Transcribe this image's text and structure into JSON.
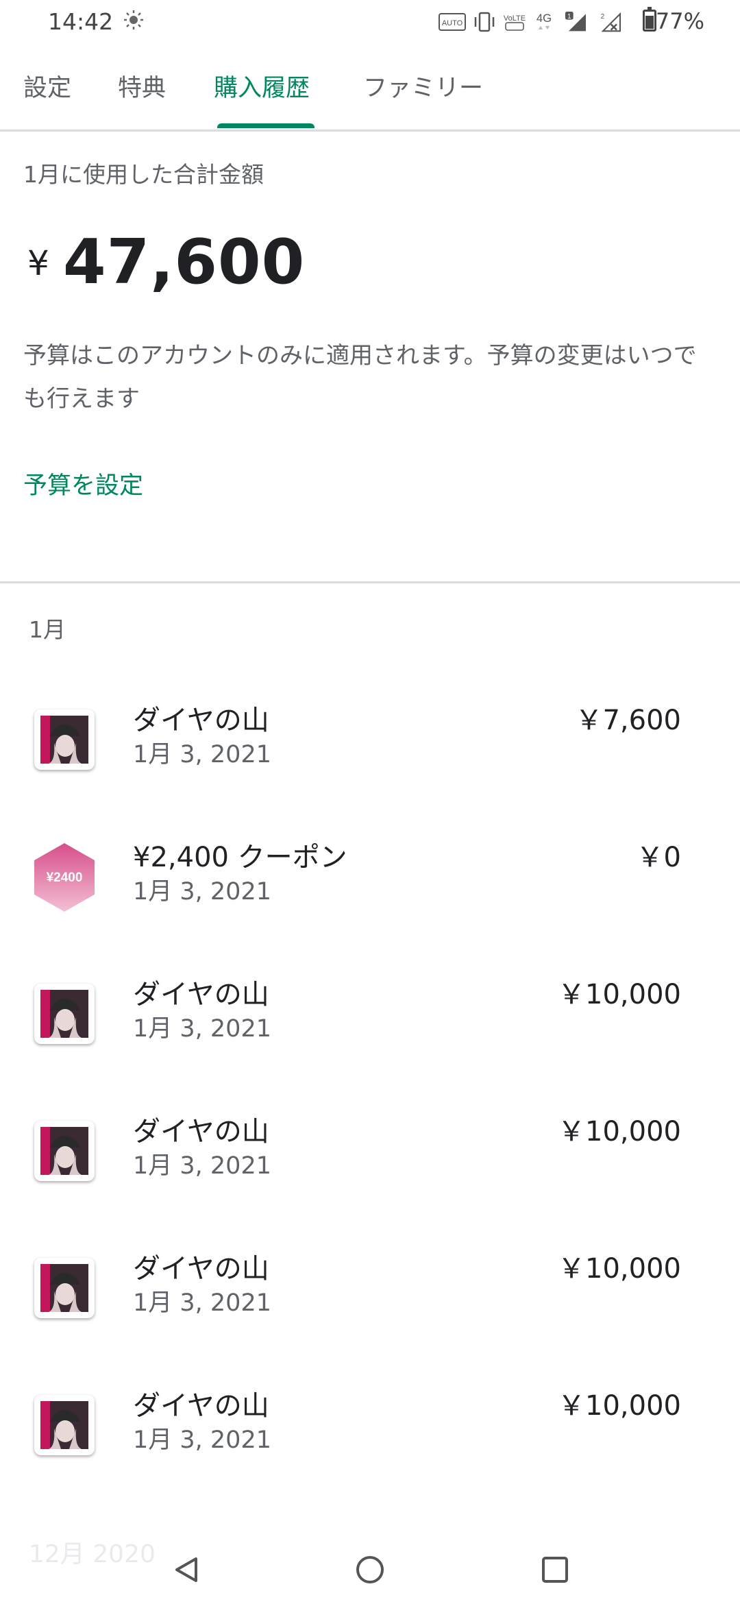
{
  "status_bar": {
    "time": "14:42",
    "battery": "77%",
    "network": "4G",
    "sim_badge": "1",
    "sim2_label": "2",
    "auto_label": "AUTO",
    "volte_label": "VoLTE"
  },
  "tabs": [
    {
      "label": "設定",
      "active": false
    },
    {
      "label": "特典",
      "active": false
    },
    {
      "label": "購入履歴",
      "active": true
    },
    {
      "label": "ファミリー",
      "active": false
    }
  ],
  "summary": {
    "label": "1月に使用した合計金額",
    "currency": "¥",
    "total": "47,600",
    "description": "予算はこのアカウントのみに適用されます。予算の変更はいつでも行えます",
    "set_budget_label": "予算を設定"
  },
  "month_header": "1月",
  "purchases": [
    {
      "name": "ダイヤの山",
      "date": "1月 3, 2021",
      "price": "￥7,600",
      "icon": "game-app-icon"
    },
    {
      "name": "¥2,400 クーポン",
      "date": "1月 3, 2021",
      "price": "￥0",
      "icon": "coupon-icon",
      "coupon_text": "¥2400"
    },
    {
      "name": "ダイヤの山",
      "date": "1月 3, 2021",
      "price": "￥10,000",
      "icon": "game-app-icon"
    },
    {
      "name": "ダイヤの山",
      "date": "1月 3, 2021",
      "price": "￥10,000",
      "icon": "game-app-icon"
    },
    {
      "name": "ダイヤの山",
      "date": "1月 3, 2021",
      "price": "￥10,000",
      "icon": "game-app-icon"
    },
    {
      "name": "ダイヤの山",
      "date": "1月 3, 2021",
      "price": "￥10,000",
      "icon": "game-app-icon"
    }
  ],
  "next_month_header": "12月 2020",
  "colors": {
    "accent": "#01875f",
    "text_primary": "#202124",
    "text_secondary": "#5f6368",
    "divider": "#dadce0",
    "coupon": "#c2185b"
  }
}
